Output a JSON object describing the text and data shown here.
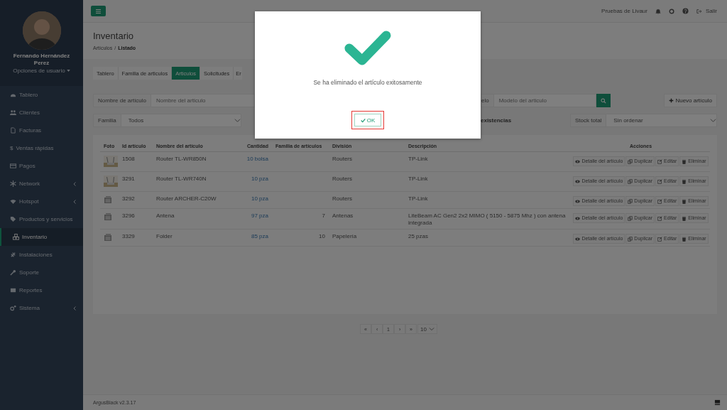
{
  "topbar": {
    "user": "Pruebas de Livaur",
    "logout": "Salir"
  },
  "sidebar": {
    "user_name": "Fernando Hernández Perez",
    "user_options": "Opciones de usuario",
    "items": [
      {
        "label": "Tablero",
        "selected": false,
        "submenu": false
      },
      {
        "label": "Clientes",
        "selected": false,
        "submenu": false
      },
      {
        "label": "Facturas",
        "selected": false,
        "submenu": false
      },
      {
        "label": "Ventas rápidas",
        "glyph": "$",
        "selected": false,
        "submenu": false
      },
      {
        "label": "Pagos",
        "selected": false,
        "submenu": false
      },
      {
        "label": "Network",
        "selected": false,
        "submenu": true
      },
      {
        "label": "Hotspot",
        "selected": false,
        "submenu": true
      },
      {
        "label": "Productos y servicios",
        "selected": false,
        "submenu": false
      },
      {
        "label": "Inventario",
        "selected": true,
        "submenu": false
      },
      {
        "label": "Instalaciones",
        "selected": false,
        "submenu": false
      },
      {
        "label": "Soporte",
        "selected": false,
        "submenu": false
      },
      {
        "label": "Reportes",
        "selected": false,
        "submenu": false
      },
      {
        "label": "Sistema",
        "selected": false,
        "submenu": true
      }
    ]
  },
  "page": {
    "title": "Inventario",
    "breadcrumb": [
      "Artículos",
      "Listado"
    ],
    "breadcrumb_separator": "/"
  },
  "tabs": [
    {
      "label": "Tablero",
      "selected": false
    },
    {
      "label": "Familia de articulos",
      "selected": false
    },
    {
      "label": "Articulos",
      "selected": true
    },
    {
      "label": "Solicitudes",
      "selected": false
    },
    {
      "label": "Er",
      "selected": false
    }
  ],
  "filters": {
    "name_label": "Nombre de artículo",
    "name_placeholder": "Nombre del articulo",
    "model_label": "elo",
    "model_placeholder": "Modelo del articulo",
    "new_button": "Nuevo artículo",
    "family_label": "Familia",
    "family_value": "Todos",
    "stock_text": "existencias",
    "stock_label": "Stock total",
    "stock_value": "Sin ordenar"
  },
  "table": {
    "columns": [
      "Foto",
      "Id artículo",
      "Nombre del artículo",
      "Cantidad",
      "Familia de artículos",
      "División",
      "Descripción",
      "Acciones"
    ],
    "rows": [
      {
        "photo": {
          "kind": "picture"
        },
        "id": "1508",
        "name": "Router TL-WR850N",
        "quantity": "10 bolsa",
        "family": "",
        "division": "Routers",
        "description": "TP-Link",
        "actions": [
          "Detalle del artículo",
          "Duplicar",
          "Editar",
          "Eliminar"
        ]
      },
      {
        "photo": {
          "kind": "picture"
        },
        "id": "3291",
        "name": "Router TL-WR740N",
        "quantity": "10 pza",
        "family": "",
        "division": "Routers",
        "description": "TP-Link",
        "actions": [
          "Detalle del artículo",
          "Duplicar",
          "Editar",
          "Eliminar"
        ]
      },
      {
        "photo": {
          "kind": "placeholder"
        },
        "id": "3292",
        "name": "Router ARCHER-C20W",
        "quantity": "10 pza",
        "family": "",
        "division": "Routers",
        "description": "TP-Link",
        "actions": [
          "Detalle del artículo",
          "Duplicar",
          "Editar",
          "Eliminar"
        ]
      },
      {
        "photo": {
          "kind": "placeholder"
        },
        "id": "3296",
        "name": "Antena",
        "quantity": "97 pza",
        "family": "7",
        "division": "Antenas",
        "description": "LiteBeam AC Gen2 2x2 MIMO ( 5150 - 5875 Mhz ) con antena integrada",
        "actions": [
          "Detalle del artículo",
          "Duplicar",
          "Editar",
          "Eliminar"
        ]
      },
      {
        "photo": {
          "kind": "placeholder"
        },
        "id": "3329",
        "name": "Folder",
        "quantity": "85 pza",
        "family": "10",
        "division": "Papelería",
        "description": "25 pzas",
        "actions": [
          "Detalle del artículo",
          "Duplicar",
          "Editar",
          "Eliminar"
        ]
      }
    ]
  },
  "pagination": {
    "buttons": [
      "«",
      "‹",
      "1",
      "›",
      "»"
    ],
    "page_size": "10"
  },
  "footer": {
    "version": "ArgusBlack v2.3.17"
  },
  "modal": {
    "message": "Se ha eliminado el artículo exitosamente",
    "ok": "OK",
    "ok_focused": true
  }
}
